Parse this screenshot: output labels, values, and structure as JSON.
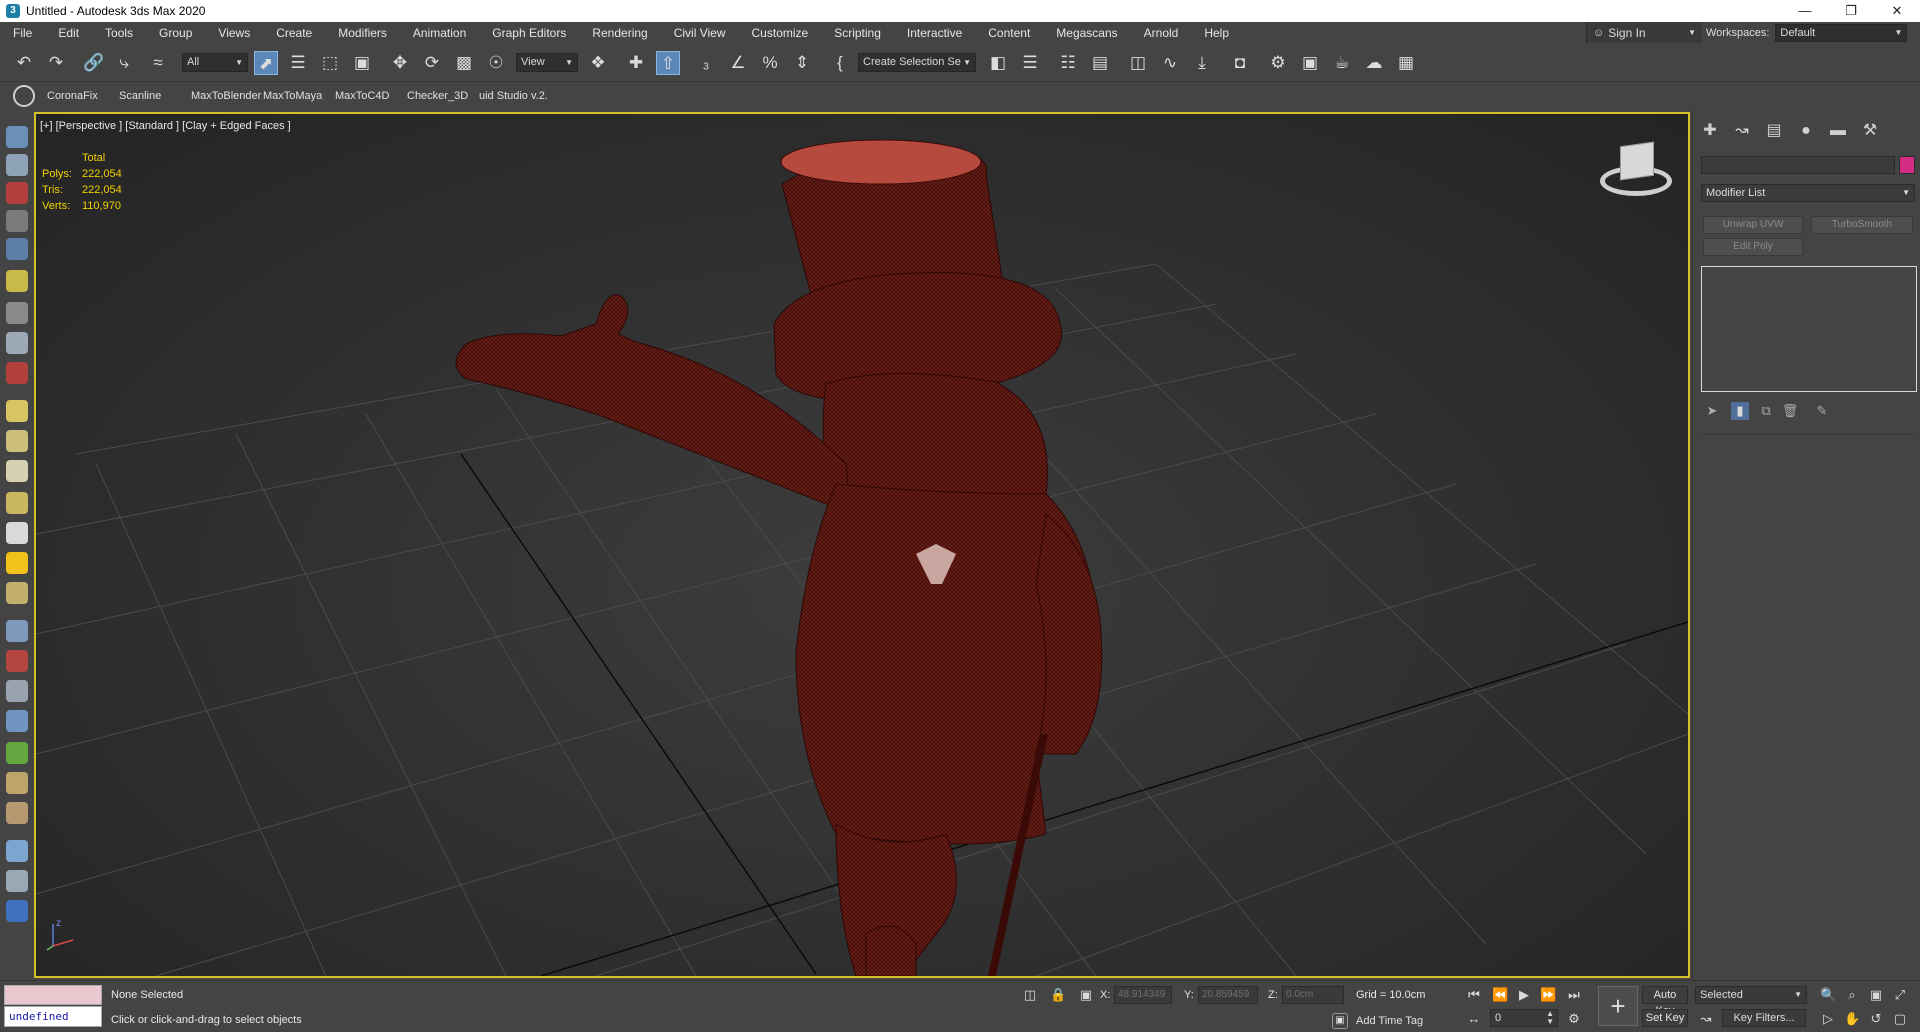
{
  "window": {
    "title": "Untitled - Autodesk 3ds Max 2020",
    "app_icon": "3",
    "minimize": "—",
    "maximize": "❐",
    "close": "✕"
  },
  "menubar": {
    "items": [
      "File",
      "Edit",
      "Tools",
      "Group",
      "Views",
      "Create",
      "Modifiers",
      "Animation",
      "Graph Editors",
      "Rendering",
      "Civil View",
      "Customize",
      "Scripting",
      "Interactive",
      "Content",
      "Megascans",
      "Arnold",
      "Help"
    ],
    "sign_in": "Sign In",
    "workspaces_label": "Workspaces:",
    "workspace": "Default"
  },
  "toolbar": {
    "selection_filter": "All",
    "ref_coord": "View",
    "named_selection": "Create Selection Se"
  },
  "shelf": {
    "items": [
      "CoronaFix",
      "Scanline",
      "MaxToBlender",
      "MaxToMaya",
      "MaxToC4D",
      "Checker_3D",
      "uid Studio v.2."
    ]
  },
  "viewport": {
    "label": "[+] [Perspective ] [Standard ] [Clay + Edged Faces ]",
    "stats": {
      "header": "Total",
      "polys_label": "Polys:",
      "polys": "222,054",
      "tris_label": "Tris:",
      "tris": "222,054",
      "verts_label": "Verts:",
      "verts": "110,970"
    },
    "mesh_color": "#5a1410",
    "gizmo_axes": {
      "z": "z"
    }
  },
  "command_panel": {
    "modifier_list": "Modifier List",
    "buttons": [
      "Unwrap UVW",
      "TurboSmooth",
      "Edit Poly"
    ],
    "object_color": "#d22c83"
  },
  "status": {
    "maxscript_value": "undefined",
    "selection": "None Selected",
    "prompt": "Click or click-and-drag to select objects",
    "x_label": "X:",
    "x_value": "48.914349",
    "y_label": "Y:",
    "y_value": "20.859459",
    "z_label": "Z:",
    "z_value": "0.0cm",
    "grid": "Grid = 10.0cm",
    "add_time_tag": "Add Time Tag",
    "frame": "0",
    "auto_key": "Auto Key",
    "set_key": "Set Key",
    "key_mode": "Selected",
    "key_filters": "Key Filters..."
  },
  "colors": {
    "accent": "#d6c028",
    "active_tool": "#5b87b9",
    "stats_text": "#f2d200"
  }
}
